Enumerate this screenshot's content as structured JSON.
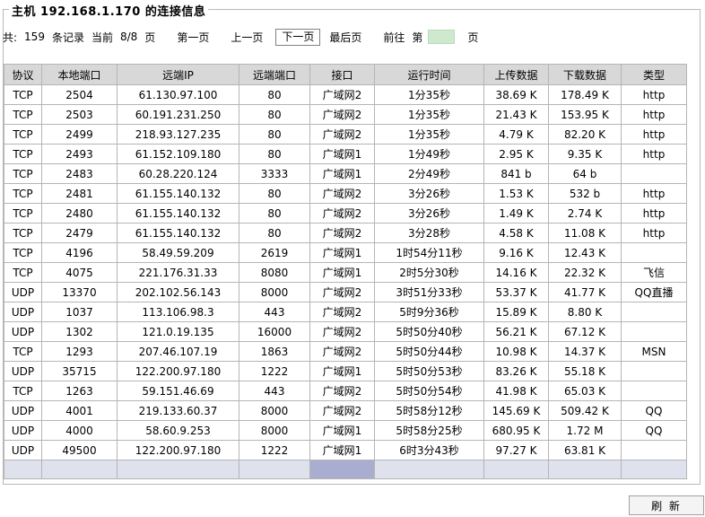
{
  "title": "主机 192.168.1.170 的连接信息",
  "pager": {
    "total_prefix": "共:",
    "total_count": "159",
    "records_label": "条记录",
    "current_label": "当前",
    "page_info": "8/8",
    "page_unit": "页",
    "first": "第一页",
    "prev": "上一页",
    "next": "下一页",
    "last": "最后页",
    "goto_label": "前往",
    "goto_prefix": "第",
    "goto_value": "",
    "goto_suffix": "页"
  },
  "table": {
    "headers": [
      "协议",
      "本地端口",
      "远端IP",
      "远端端口",
      "接口",
      "运行时间",
      "上传数据",
      "下载数据",
      "类型"
    ],
    "rows": [
      [
        "TCP",
        "2504",
        "61.130.97.100",
        "80",
        "广域网2",
        "1分35秒",
        "38.69 K",
        "178.49 K",
        "http"
      ],
      [
        "TCP",
        "2503",
        "60.191.231.250",
        "80",
        "广域网2",
        "1分35秒",
        "21.43 K",
        "153.95 K",
        "http"
      ],
      [
        "TCP",
        "2499",
        "218.93.127.235",
        "80",
        "广域网2",
        "1分35秒",
        "4.79 K",
        "82.20 K",
        "http"
      ],
      [
        "TCP",
        "2493",
        "61.152.109.180",
        "80",
        "广域网1",
        "1分49秒",
        "2.95 K",
        "9.35 K",
        "http"
      ],
      [
        "TCP",
        "2483",
        "60.28.220.124",
        "3333",
        "广域网1",
        "2分49秒",
        "841 b",
        "64 b",
        ""
      ],
      [
        "TCP",
        "2481",
        "61.155.140.132",
        "80",
        "广域网2",
        "3分26秒",
        "1.53 K",
        "532 b",
        "http"
      ],
      [
        "TCP",
        "2480",
        "61.155.140.132",
        "80",
        "广域网2",
        "3分26秒",
        "1.49 K",
        "2.74 K",
        "http"
      ],
      [
        "TCP",
        "2479",
        "61.155.140.132",
        "80",
        "广域网2",
        "3分28秒",
        "4.58 K",
        "11.08 K",
        "http"
      ],
      [
        "TCP",
        "4196",
        "58.49.59.209",
        "2619",
        "广域网1",
        "1时54分11秒",
        "9.16 K",
        "12.43 K",
        ""
      ],
      [
        "TCP",
        "4075",
        "221.176.31.33",
        "8080",
        "广域网1",
        "2时5分30秒",
        "14.16 K",
        "22.32 K",
        "飞信"
      ],
      [
        "UDP",
        "13370",
        "202.102.56.143",
        "8000",
        "广域网2",
        "3时51分33秒",
        "53.37 K",
        "41.77 K",
        "QQ直播"
      ],
      [
        "UDP",
        "1037",
        "113.106.98.3",
        "443",
        "广域网2",
        "5时9分36秒",
        "15.89 K",
        "8.80 K",
        ""
      ],
      [
        "UDP",
        "1302",
        "121.0.19.135",
        "16000",
        "广域网2",
        "5时50分40秒",
        "56.21 K",
        "67.12 K",
        ""
      ],
      [
        "TCP",
        "1293",
        "207.46.107.19",
        "1863",
        "广域网2",
        "5时50分44秒",
        "10.98 K",
        "14.37 K",
        "MSN"
      ],
      [
        "UDP",
        "35715",
        "122.200.97.180",
        "1222",
        "广域网1",
        "5时50分53秒",
        "83.26 K",
        "55.18 K",
        ""
      ],
      [
        "TCP",
        "1263",
        "59.151.46.69",
        "443",
        "广域网2",
        "5时50分54秒",
        "41.98 K",
        "65.03 K",
        ""
      ],
      [
        "UDP",
        "4001",
        "219.133.60.37",
        "8000",
        "广域网2",
        "5时58分12秒",
        "145.69 K",
        "509.42 K",
        "QQ"
      ],
      [
        "UDP",
        "4000",
        "58.60.9.253",
        "8000",
        "广域网1",
        "5时58分25秒",
        "680.95 K",
        "1.72 M",
        "QQ"
      ],
      [
        "UDP",
        "49500",
        "122.200.97.180",
        "1222",
        "广域网1",
        "6时3分43秒",
        "97.27 K",
        "63.81 K",
        ""
      ]
    ]
  },
  "refresh_label": "刷 新"
}
